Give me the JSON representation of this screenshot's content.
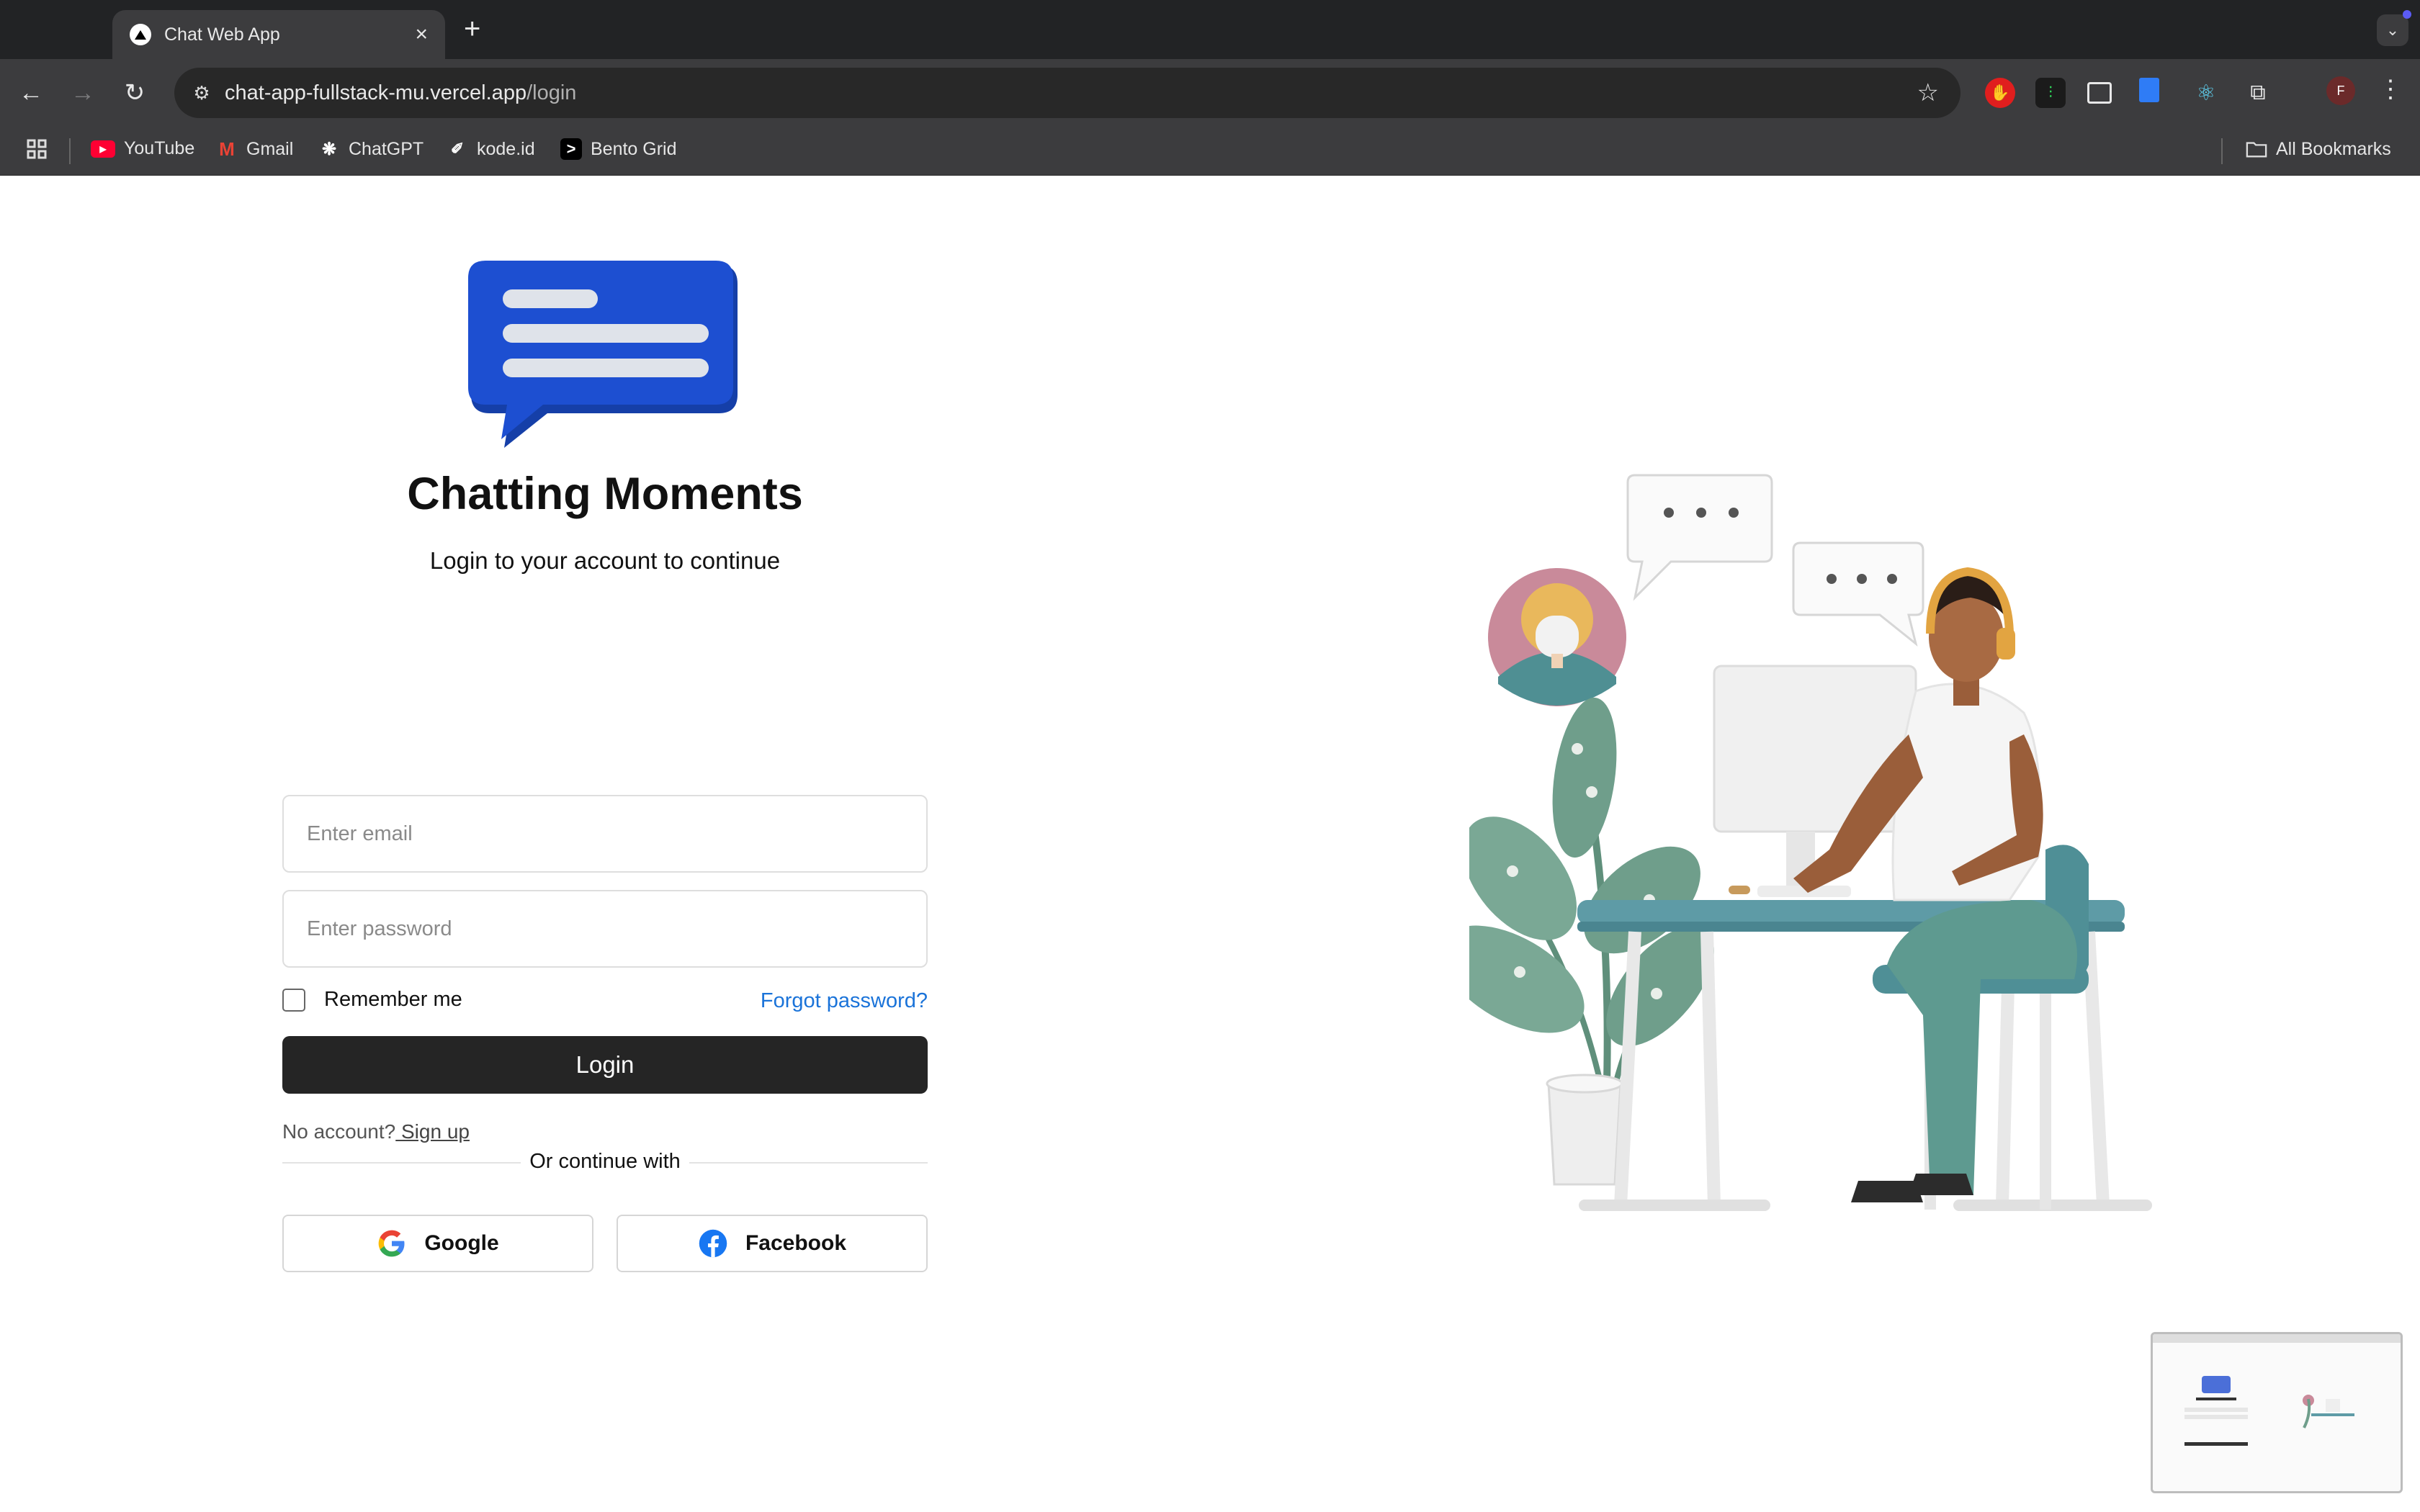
{
  "browser": {
    "tab_title": "Chat Web App",
    "new_tab": "+",
    "url_host": "chat-app-fullstack-mu.vercel.app",
    "url_path": "/login",
    "profile_initial": "F",
    "bookmarks": [
      {
        "label": "YouTube",
        "icon": "youtube-icon",
        "color": "#ff0033"
      },
      {
        "label": "Gmail",
        "icon": "gmail-icon",
        "color": "#ea4335"
      },
      {
        "label": "ChatGPT",
        "icon": "chatgpt-icon",
        "color": "#ffffff"
      },
      {
        "label": "kode.id",
        "icon": "kode-icon",
        "color": "#ffffff"
      },
      {
        "label": "Bento Grid",
        "icon": "bento-icon",
        "color": "#ffffff"
      }
    ],
    "all_bookmarks": "All Bookmarks"
  },
  "login": {
    "brand": "Chatting Moments",
    "subtitle": "Login to your account to continue",
    "email_placeholder": "Enter email",
    "password_placeholder": "Enter password",
    "remember_label": "Remember me",
    "forgot_label": "Forgot password?",
    "login_button": "Login",
    "no_account": "No account?",
    "signup_link": " Sign up",
    "or_continue": "Or continue with",
    "google_label": "Google",
    "facebook_label": "Facebook"
  },
  "colors": {
    "accent": "#1a73d9",
    "primary_button": "#252525",
    "logo_blue": "#1d4fd1"
  }
}
